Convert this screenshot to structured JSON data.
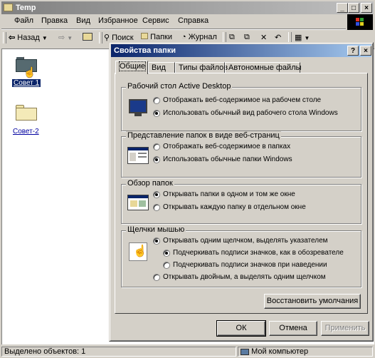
{
  "explorer": {
    "title": "Temp",
    "menu": [
      "Файл",
      "Правка",
      "Вид",
      "Избранное",
      "Сервис",
      "Справка"
    ],
    "toolbar": {
      "back": "Назад",
      "search": "Поиск",
      "folders": "Папки",
      "history": "Журнал"
    },
    "files": [
      {
        "name": "Совет 1",
        "selected": true
      },
      {
        "name": "Совет-2",
        "selected": false
      }
    ],
    "status": {
      "selected": "Выделено объектов: 1",
      "location": "Мой компьютер"
    }
  },
  "dialog": {
    "title": "Свойства папки",
    "tabs": [
      "Общие",
      "Вид",
      "Типы файлов",
      "Автономные файлы"
    ],
    "groups": {
      "desktop": {
        "title": "Рабочий стол Active Desktop",
        "options": [
          "Отображать веб-содержимое на рабочем столе",
          "Использовать обычный вид рабочего стола Windows"
        ]
      },
      "web_view": {
        "title": "Представление папок в виде веб-страниц",
        "options": [
          "Отображать веб-содержимое в папках",
          "Использовать обычные папки Windows"
        ]
      },
      "browse": {
        "title": "Обзор папок",
        "options": [
          "Открывать папки в одном и том же окне",
          "Открывать каждую папку в отдельном окне"
        ]
      },
      "clicks": {
        "title": "Щелчки мышью",
        "options": [
          "Открывать одним щелчком, выделять указателем",
          "Подчеркивать подписи значков, как в обозревателе",
          "Подчеркивать подписи значков при наведении",
          "Открывать двойным, а выделять одним щелчком"
        ]
      }
    },
    "restore_defaults": "Восстановить умолчания",
    "ok": "ОК",
    "cancel": "Отмена",
    "apply": "Применить"
  },
  "colors": {
    "title_active": "#0a246a",
    "title_inactive": "#808080",
    "selection": "#0a246a",
    "face": "#d4d0c8"
  }
}
